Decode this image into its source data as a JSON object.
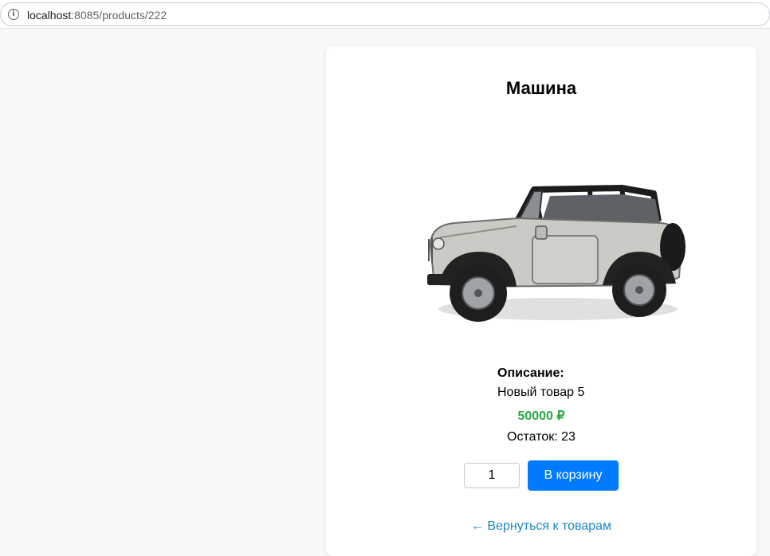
{
  "browser": {
    "url_host": "localhost",
    "url_path": ":8085/products/222",
    "info_icon": "info-icon"
  },
  "product": {
    "title": "Машина",
    "image_icon": "jeep-car-photo",
    "description_label": "Описание:",
    "description": "Новый товар 5",
    "price": "50000 ₽",
    "stock_label": "Остаток:",
    "stock_value": "23",
    "quantity": "1",
    "add_to_cart_label": "В корзину",
    "back_link": "← Вернуться к товарам"
  },
  "colors": {
    "accent": "#007bff",
    "price": "#28a745",
    "link": "#1a86c8"
  }
}
